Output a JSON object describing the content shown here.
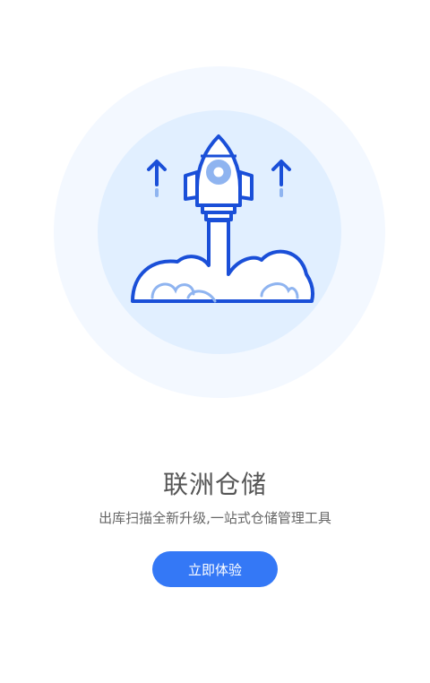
{
  "splash": {
    "title": "联洲仓储",
    "subtitle": "出库扫描全新升级,一站式仓储管理工具",
    "cta_label": "立即体验"
  },
  "illustration": {
    "icon": "rocket-launch-icon",
    "colors": {
      "outer_circle": "#f3f8ff",
      "inner_circle": "#e1efff",
      "stroke": "#1a4fd8",
      "accent": "#8fb4f0"
    }
  },
  "colors": {
    "primary": "#3478f6",
    "title": "#555555",
    "subtitle": "#666666"
  }
}
